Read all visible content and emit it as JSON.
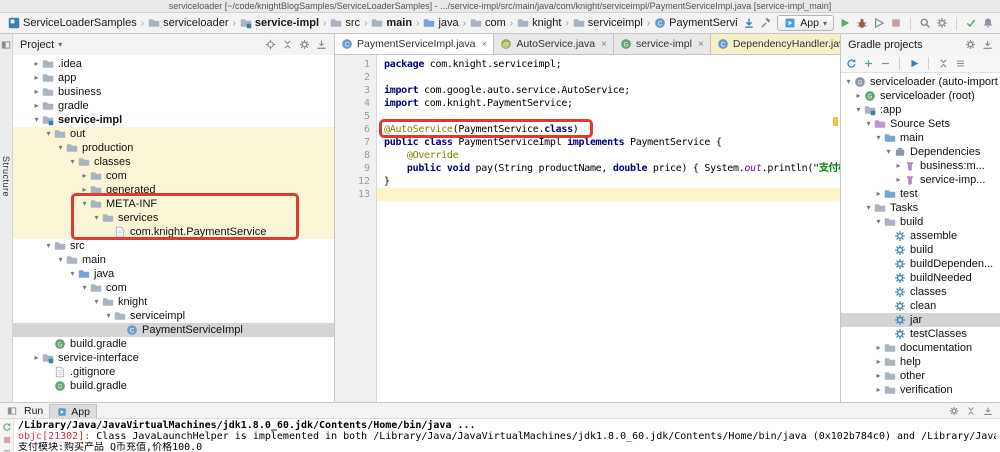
{
  "window_title": "serviceloader [~/code/knightBlogSamples/ServiceLoaderSamples] - .../service-impl/src/main/java/com/knight/serviceimpl/PaymentServiceImpl.java [service-impl_main]",
  "activity_bar": {
    "label": "Structure"
  },
  "toolbar": {
    "breadcrumbs": [
      {
        "label": "ServiceLoaderSamples",
        "icon": "project-logo"
      },
      {
        "label": "serviceloader",
        "icon": "folder"
      },
      {
        "label": "service-impl",
        "icon": "module",
        "bold": true
      },
      {
        "label": "src",
        "icon": "folder"
      },
      {
        "label": "main",
        "icon": "folder",
        "bold": true
      },
      {
        "label": "java",
        "icon": "folder-src"
      },
      {
        "label": "com",
        "icon": "folder"
      },
      {
        "label": "knight",
        "icon": "folder"
      },
      {
        "label": "serviceimpl",
        "icon": "folder"
      },
      {
        "label": "PaymentServiceImpl",
        "icon": "class"
      }
    ],
    "left_icons": [
      "vcs-down",
      "hammer"
    ],
    "run_config": "App",
    "run_icons": [
      "play-green",
      "debug-bug",
      "coverage",
      "stop",
      "sep",
      "magnifier",
      "gear-gray",
      "sep",
      "vcs-check",
      "bell"
    ]
  },
  "project_panel": {
    "title": "Project",
    "header_icons": [
      "target",
      "collapse-all",
      "gear-gray",
      "hide-panel"
    ],
    "tree": [
      {
        "l": ".idea",
        "d": 1,
        "ch": "c",
        "ic": "folder"
      },
      {
        "l": "app",
        "d": 1,
        "ch": "c",
        "ic": "folder"
      },
      {
        "l": "business",
        "d": 1,
        "ch": "c",
        "ic": "folder"
      },
      {
        "l": "gradle",
        "d": 1,
        "ch": "c",
        "ic": "folder"
      },
      {
        "l": "service-impl",
        "d": 1,
        "ch": "o",
        "ic": "module",
        "b": true
      },
      {
        "l": "out",
        "d": 2,
        "ch": "o",
        "ic": "folder",
        "y": true
      },
      {
        "l": "production",
        "d": 3,
        "ch": "o",
        "ic": "folder",
        "y": true
      },
      {
        "l": "classes",
        "d": 4,
        "ch": "o",
        "ic": "folder",
        "y": true
      },
      {
        "l": "com",
        "d": 5,
        "ch": "c",
        "ic": "folder",
        "y": true
      },
      {
        "l": "generated",
        "d": 5,
        "ch": "c",
        "ic": "folder",
        "y": true
      },
      {
        "l": "META-INF",
        "d": 5,
        "ch": "o",
        "ic": "folder",
        "y": true
      },
      {
        "l": "services",
        "d": 6,
        "ch": "o",
        "ic": "folder",
        "y": true
      },
      {
        "l": "com.knight.PaymentService",
        "d": 7,
        "ic": "file",
        "y": true
      },
      {
        "l": "src",
        "d": 2,
        "ch": "o",
        "ic": "folder"
      },
      {
        "l": "main",
        "d": 3,
        "ch": "o",
        "ic": "folder"
      },
      {
        "l": "java",
        "d": 4,
        "ch": "o",
        "ic": "folder-src"
      },
      {
        "l": "com",
        "d": 5,
        "ch": "o",
        "ic": "folder"
      },
      {
        "l": "knight",
        "d": 6,
        "ch": "o",
        "ic": "folder"
      },
      {
        "l": "serviceimpl",
        "d": 7,
        "ch": "o",
        "ic": "folder"
      },
      {
        "l": "PaymentServiceImpl",
        "d": 8,
        "ic": "class",
        "sel": true
      },
      {
        "l": "build.gradle",
        "d": 2,
        "ic": "gradle"
      },
      {
        "l": "service-interface",
        "d": 1,
        "ch": "c",
        "ic": "module"
      },
      {
        "l": ".gitignore",
        "d": 2,
        "ic": "file"
      },
      {
        "l": "build.gradle",
        "d": 2,
        "ic": "gradle"
      }
    ]
  },
  "editor": {
    "tabs": [
      {
        "label": "PaymentServiceImpl.java",
        "icon": "class",
        "active": true
      },
      {
        "label": "AutoService.java",
        "icon": "annotation"
      },
      {
        "label": "service-impl",
        "icon": "gradle"
      },
      {
        "label": "DependencyHandler.java",
        "icon": "class",
        "modified": true
      }
    ],
    "lines": [
      {
        "num": "1",
        "segs": [
          {
            "t": "package ",
            "c": "kw"
          },
          {
            "t": "com.knight.serviceimpl;",
            "c": "pl"
          }
        ]
      },
      {
        "num": "2",
        "segs": []
      },
      {
        "num": "3",
        "segs": [
          {
            "t": "import ",
            "c": "kw"
          },
          {
            "t": "com.google.auto.service.AutoService;",
            "c": "pl"
          }
        ]
      },
      {
        "num": "4",
        "segs": [
          {
            "t": "import ",
            "c": "kw"
          },
          {
            "t": "com.knight.PaymentService;",
            "c": "pl"
          }
        ]
      },
      {
        "num": "5",
        "segs": []
      },
      {
        "num": "6",
        "segs": [
          {
            "t": "@AutoService",
            "c": "ann"
          },
          {
            "t": "(PaymentService.",
            "c": "pl"
          },
          {
            "t": "class",
            "c": "kw"
          },
          {
            "t": ")",
            "c": "pl"
          }
        ]
      },
      {
        "num": "7",
        "segs": [
          {
            "t": "public class ",
            "c": "kw"
          },
          {
            "t": "PaymentServiceImpl ",
            "c": "pl"
          },
          {
            "t": "implements",
            "c": "kw"
          },
          {
            "t": " PaymentService {",
            "c": "pl"
          }
        ]
      },
      {
        "num": "8",
        "segs": [
          {
            "t": "    ",
            "c": "pl"
          },
          {
            "t": "@Override",
            "c": "ann"
          }
        ]
      },
      {
        "num": "9",
        "segs": [
          {
            "t": "    ",
            "c": "pl"
          },
          {
            "t": "public void ",
            "c": "kw"
          },
          {
            "t": "pay(String productName, ",
            "c": "pl"
          },
          {
            "t": "double",
            "c": "kw"
          },
          {
            "t": " price) { System.",
            "c": "pl"
          },
          {
            "t": "out",
            "c": "fld"
          },
          {
            "t": ".println(",
            "c": "pl"
          },
          {
            "t": "\"支付模块:购",
            "c": "str"
          }
        ]
      },
      {
        "num": "12",
        "segs": [
          {
            "t": "}",
            "c": "pl"
          }
        ]
      },
      {
        "num": "13",
        "segs": [],
        "current": true
      }
    ]
  },
  "gradle_panel": {
    "title": "Gradle projects",
    "header_icons": [
      "gear-gray",
      "hide-panel"
    ],
    "toolbar_icons": [
      "refresh",
      "plus",
      "minus",
      "sep",
      "play-blue",
      "sep",
      "collapse-all",
      "menu"
    ],
    "tree": [
      {
        "l": "serviceloader (auto-import",
        "d": 0,
        "ch": "o",
        "ic": "gradle-root"
      },
      {
        "l": "serviceloader (root)",
        "d": 1,
        "ch": "c",
        "ic": "gradle"
      },
      {
        "l": ":app",
        "d": 1,
        "ch": "o",
        "ic": "module"
      },
      {
        "l": "Source Sets",
        "d": 2,
        "ch": "o",
        "ic": "sourcesets"
      },
      {
        "l": "main",
        "d": 3,
        "ch": "o",
        "ic": "sourceset"
      },
      {
        "l": "Dependencies",
        "d": 4,
        "ch": "o",
        "ic": "deps"
      },
      {
        "l": "business:m...",
        "d": 5,
        "ch": "c",
        "ic": "jar"
      },
      {
        "l": "service-imp...",
        "d": 5,
        "ch": "c",
        "ic": "jar"
      },
      {
        "l": "test",
        "d": 3,
        "ch": "c",
        "ic": "sourceset"
      },
      {
        "l": "Tasks",
        "d": 2,
        "ch": "o",
        "ic": "folder"
      },
      {
        "l": "build",
        "d": 3,
        "ch": "o",
        "ic": "folder"
      },
      {
        "l": "assemble",
        "d": 4,
        "ic": "gear-task"
      },
      {
        "l": "build",
        "d": 4,
        "ic": "gear-task"
      },
      {
        "l": "buildDependen...",
        "d": 4,
        "ic": "gear-task"
      },
      {
        "l": "buildNeeded",
        "d": 4,
        "ic": "gear-task"
      },
      {
        "l": "classes",
        "d": 4,
        "ic": "gear-task"
      },
      {
        "l": "clean",
        "d": 4,
        "ic": "gear-task"
      },
      {
        "l": "jar",
        "d": 4,
        "ic": "gear-task",
        "sel": true
      },
      {
        "l": "testClasses",
        "d": 4,
        "ic": "gear-task"
      },
      {
        "l": "documentation",
        "d": 3,
        "ch": "c",
        "ic": "folder"
      },
      {
        "l": "help",
        "d": 3,
        "ch": "c",
        "ic": "folder"
      },
      {
        "l": "other",
        "d": 3,
        "ch": "c",
        "ic": "folder"
      },
      {
        "l": "verification",
        "d": 3,
        "ch": "c",
        "ic": "folder"
      }
    ]
  },
  "run_panel": {
    "title": "Run",
    "tab": "App",
    "header_icons": [
      "gear-gray",
      "collapse-all",
      "hide-panel"
    ],
    "strip_icons": [
      "rerun",
      "stop-red",
      "menu"
    ],
    "console": [
      {
        "segs": [
          {
            "t": "/Library/Java/JavaVirtualMachines/jdk1.8.0_60.jdk/Contents/Home/bin/java ...",
            "c": "bold"
          }
        ]
      },
      {
        "segs": [
          {
            "t": "objc[21302]: ",
            "c": "err"
          },
          {
            "t": "Class JavaLaunchHelper is implemented in both /Library/Java/JavaVirtualMachines/jdk1.8.0_60.jdk/Contents/Home/bin/java (0x102b784c0) and /Library/Java/JavaVirtualMachine",
            "c": "pl"
          }
        ]
      },
      {
        "segs": [
          {
            "t": "支付模块:购买产品 Q币充值,价格100.0",
            "c": "pl"
          }
        ]
      }
    ]
  },
  "colors": {
    "annotation_red": "#e2392e",
    "selection_gray": "#d5d5d5",
    "scope_yellow": "#fbf5d7",
    "keyword_blue": "#000080",
    "string_green": "#008000"
  }
}
